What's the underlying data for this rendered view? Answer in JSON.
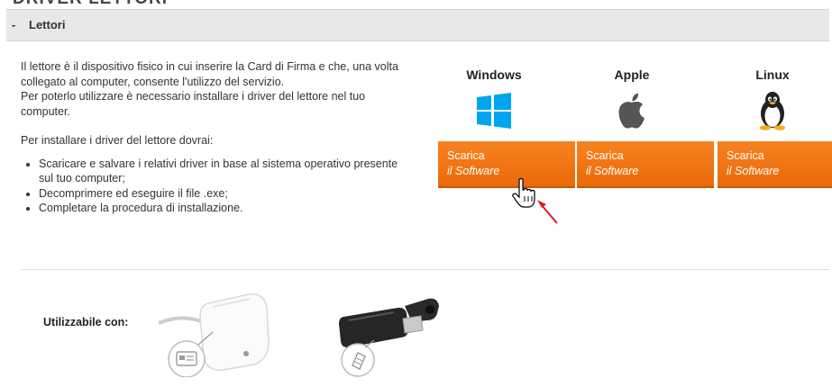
{
  "page": {
    "heading": "DRIVER LETTORI"
  },
  "panel": {
    "toggle": "-",
    "title": "Lettori"
  },
  "intro": {
    "p1": "Il lettore è il dispositivo fisico in cui inserire la Card di Firma e che, una volta collegato al computer, consente l'utilizzo del servizio.",
    "p2": "Per poterlo utilizzare è necessario installare i driver del lettore nel tuo computer.",
    "p3": "Per installare i driver del lettore dovrai:",
    "steps": [
      "Scaricare e salvare i relativi driver in base al sistema operativo presente sul tuo computer;",
      "Decomprimere ed eseguire il file .exe;",
      "Completare la procedura di installazione."
    ]
  },
  "downloads": [
    {
      "os": "Windows",
      "icon": "windows-logo-icon",
      "line1": "Scarica",
      "line2": "il Software"
    },
    {
      "os": "Apple",
      "icon": "apple-logo-icon",
      "line1": "Scarica",
      "line2": "il Software"
    },
    {
      "os": "Linux",
      "icon": "linux-tux-icon",
      "line1": "Scarica",
      "line2": "il Software"
    }
  ],
  "usable": {
    "label": "Utilizzabile con:"
  },
  "colors": {
    "button": "#f47b1a",
    "header_bg": "#e8e8e8",
    "windows_blue": "#00a4ef",
    "annotation_arrow": "#d62020"
  }
}
